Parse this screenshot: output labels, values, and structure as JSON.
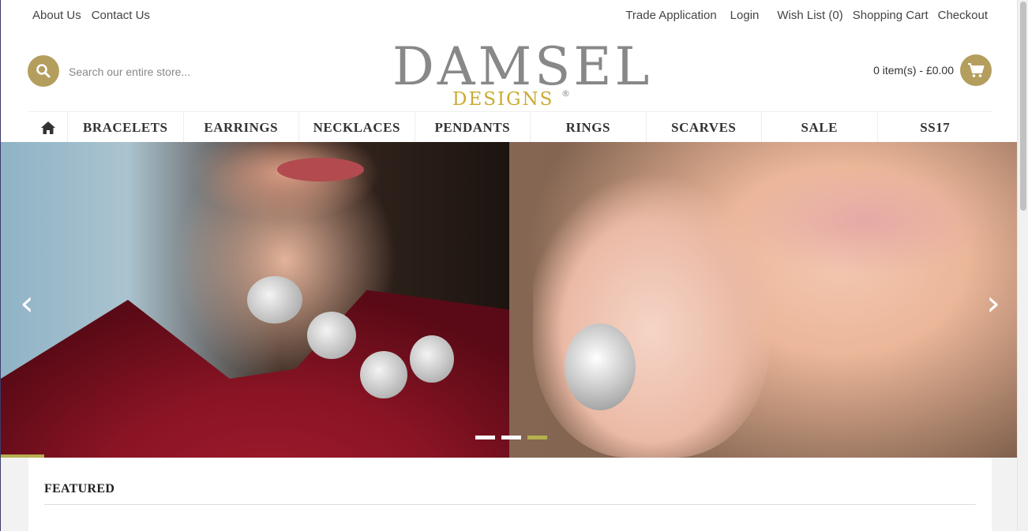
{
  "topbar": {
    "left_links": [
      "About Us",
      "Contact Us"
    ],
    "right_links": [
      "Trade Application",
      "Login",
      "Wish List (0)",
      "Shopping Cart",
      "Checkout"
    ]
  },
  "search": {
    "placeholder": "Search our entire store...",
    "value": ""
  },
  "logo": {
    "main": "DAMSEL",
    "sub": "DESIGNS",
    "reg": "®"
  },
  "cart": {
    "summary": "0 item(s) - £0.00"
  },
  "nav": {
    "items": [
      "BRACELETS",
      "EARRINGS",
      "NECKLACES",
      "PENDANTS",
      "RINGS",
      "SCARVES",
      "SALE",
      "SS17"
    ]
  },
  "slider": {
    "prev": "‹",
    "next": "›",
    "slide_count": 3,
    "active_index": 2
  },
  "featured": {
    "title": "FEATURED"
  },
  "colors": {
    "accent": "#b49e5d",
    "logo_gold": "#c9ab2f",
    "dot_active": "#b5b04f"
  },
  "icons": [
    "search-icon",
    "cart-icon",
    "home-icon"
  ]
}
